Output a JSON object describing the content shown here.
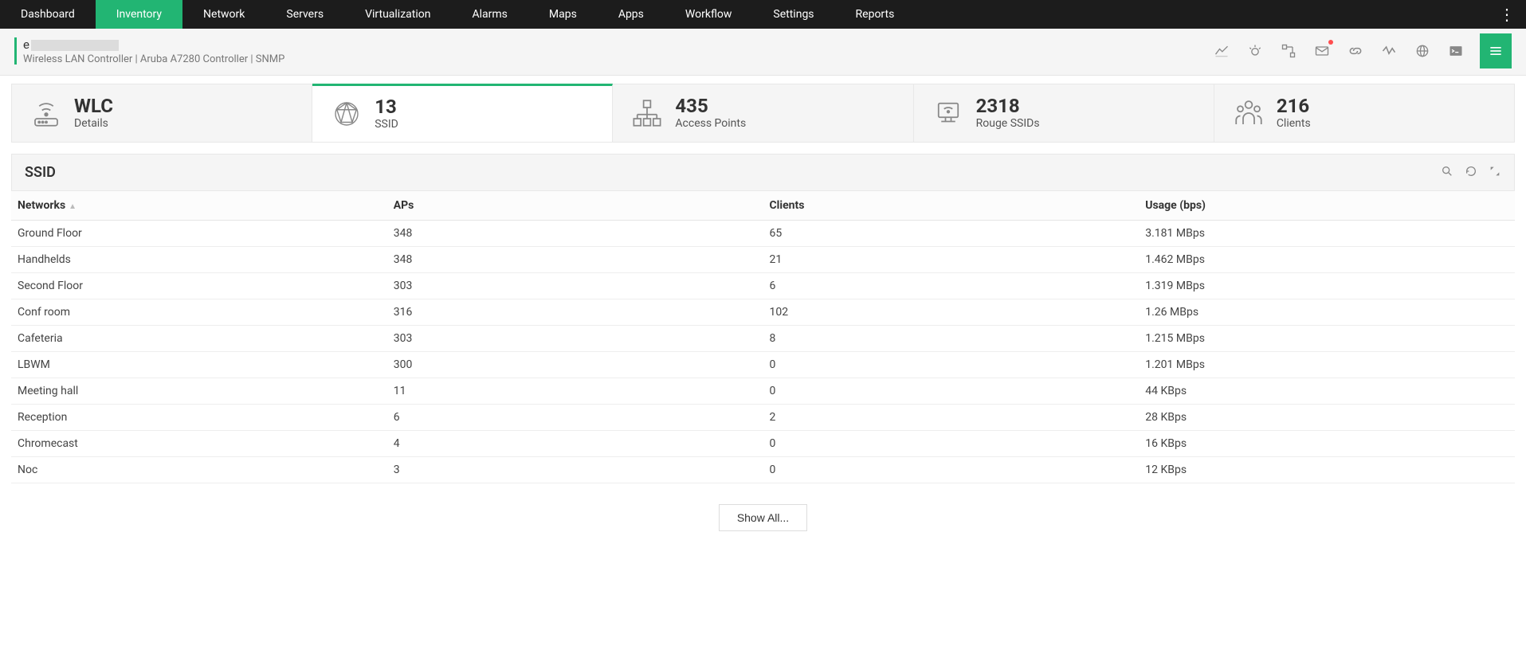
{
  "nav": {
    "items": [
      "Dashboard",
      "Inventory",
      "Network",
      "Servers",
      "Virtualization",
      "Alarms",
      "Maps",
      "Apps",
      "Workflow",
      "Settings",
      "Reports"
    ],
    "active_index": 1
  },
  "device": {
    "name_prefix": "e",
    "subtitle": "Wireless LAN Controller | Aruba A7280 Controller  | SNMP"
  },
  "stats": [
    {
      "value": "WLC",
      "label": "Details",
      "icon": "wlc"
    },
    {
      "value": "13",
      "label": "SSID",
      "icon": "globe"
    },
    {
      "value": "435",
      "label": "Access Points",
      "icon": "ap"
    },
    {
      "value": "2318",
      "label": "Rouge SSIDs",
      "icon": "rogue"
    },
    {
      "value": "216",
      "label": "Clients",
      "icon": "clients"
    }
  ],
  "stats_active_index": 1,
  "panel_title": "SSID",
  "columns": [
    "Networks",
    "APs",
    "Clients",
    "Usage (bps)"
  ],
  "rows": [
    {
      "network": "Ground Floor",
      "aps": "348",
      "clients": "65",
      "usage": "3.181 MBps"
    },
    {
      "network": "Handhelds",
      "aps": "348",
      "clients": "21",
      "usage": "1.462 MBps"
    },
    {
      "network": "Second Floor",
      "aps": "303",
      "clients": "6",
      "usage": "1.319 MBps"
    },
    {
      "network": "Conf room",
      "aps": "316",
      "clients": "102",
      "usage": "1.26 MBps"
    },
    {
      "network": "Cafeteria",
      "aps": "303",
      "clients": "8",
      "usage": "1.215 MBps"
    },
    {
      "network": "LBWM",
      "aps": "300",
      "clients": "0",
      "usage": "1.201 MBps"
    },
    {
      "network": "Meeting hall",
      "aps": "11",
      "clients": "0",
      "usage": "44 KBps"
    },
    {
      "network": "Reception",
      "aps": "6",
      "clients": "2",
      "usage": "28 KBps"
    },
    {
      "network": "Chromecast",
      "aps": "4",
      "clients": "0",
      "usage": "16 KBps"
    },
    {
      "network": "Noc",
      "aps": "3",
      "clients": "0",
      "usage": "12 KBps"
    }
  ],
  "show_all_label": "Show All..."
}
